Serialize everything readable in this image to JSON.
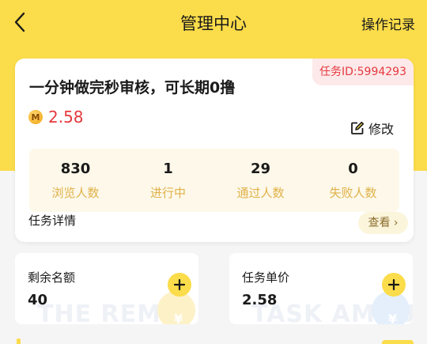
{
  "nav": {
    "title": "管理中心",
    "right_label": "操作记录"
  },
  "task": {
    "id_badge": "任务ID:5994293",
    "title": "一分钟做完秒审核，可长期0撸",
    "coin_symbol": "M",
    "price": "2.58",
    "edit_label": "修改",
    "stats": [
      {
        "value": "830",
        "label": "浏览人数"
      },
      {
        "value": "1",
        "label": "进行中"
      },
      {
        "value": "29",
        "label": "通过人数"
      },
      {
        "value": "0",
        "label": "失败人数"
      }
    ],
    "detail_label": "任务详情",
    "view_label": "查看 ›"
  },
  "cards": {
    "remaining": {
      "label": "剩余名额",
      "value": "40",
      "watermark": "THE REMAI"
    },
    "unit_price": {
      "label": "任务单价",
      "value": "2.58",
      "watermark": "TASK AMOU"
    }
  },
  "colors": {
    "accent_yellow": "#fbdc4a",
    "price_red": "#e5393f",
    "stat_label_gold": "#e0b24a"
  },
  "icons": {
    "back": "chevron-left-icon",
    "edit": "edit-icon",
    "coin": "coin-icon",
    "plus": "plus-icon"
  }
}
